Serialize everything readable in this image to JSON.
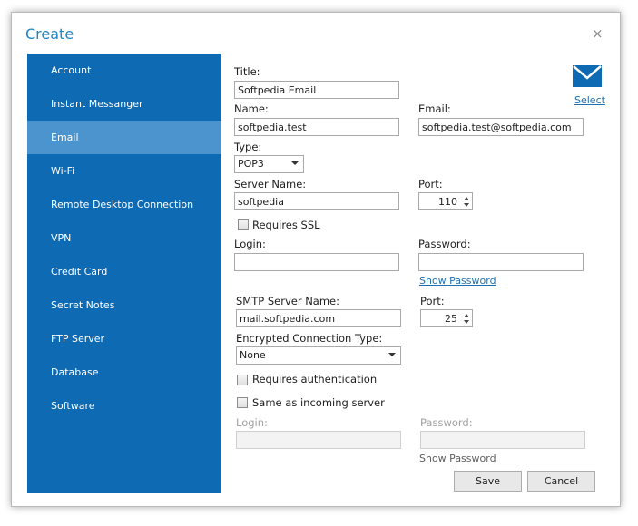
{
  "window": {
    "title": "Create",
    "close_glyph": "×"
  },
  "sidebar": {
    "items": [
      {
        "label": "Account"
      },
      {
        "label": "Instant Messanger"
      },
      {
        "label": "Email",
        "active": true
      },
      {
        "label": "Wi-Fi"
      },
      {
        "label": "Remote Desktop Connection"
      },
      {
        "label": "VPN"
      },
      {
        "label": "Credit Card"
      },
      {
        "label": "Secret Notes"
      },
      {
        "label": "FTP Server"
      },
      {
        "label": "Database"
      },
      {
        "label": "Software"
      }
    ]
  },
  "icon": {
    "name": "envelope-icon",
    "select_label": "Select"
  },
  "form": {
    "title_label": "Title:",
    "title_value": "Softpedia Email",
    "name_label": "Name:",
    "name_value": "softpedia.test",
    "email_label": "Email:",
    "email_value": "softpedia.test@softpedia.com",
    "type_label": "Type:",
    "type_value": "POP3",
    "server_label": "Server Name:",
    "server_value": "softpedia",
    "port_label": "Port:",
    "port_value": "110",
    "ssl_label": "Requires SSL",
    "login_label": "Login:",
    "login_value": "",
    "password_label": "Password:",
    "password_value": "",
    "show_password": "Show Password",
    "smtp_label": "SMTP Server Name:",
    "smtp_value": "mail.softpedia.com",
    "smtp_port_label": "Port:",
    "smtp_port_value": "25",
    "enc_label": "Encrypted Connection Type:",
    "enc_value": "None",
    "auth_label": "Requires authentication",
    "same_label": "Same as incoming server",
    "smtp_login_label": "Login:",
    "smtp_login_value": "",
    "smtp_password_label": "Password:",
    "smtp_password_value": "",
    "smtp_show_password": "Show Password"
  },
  "buttons": {
    "save": "Save",
    "cancel": "Cancel"
  },
  "colors": {
    "accent": "#0f6ab4",
    "active_item": "#4b94ce",
    "title": "#1f86c9",
    "link": "#1f6fb2"
  }
}
